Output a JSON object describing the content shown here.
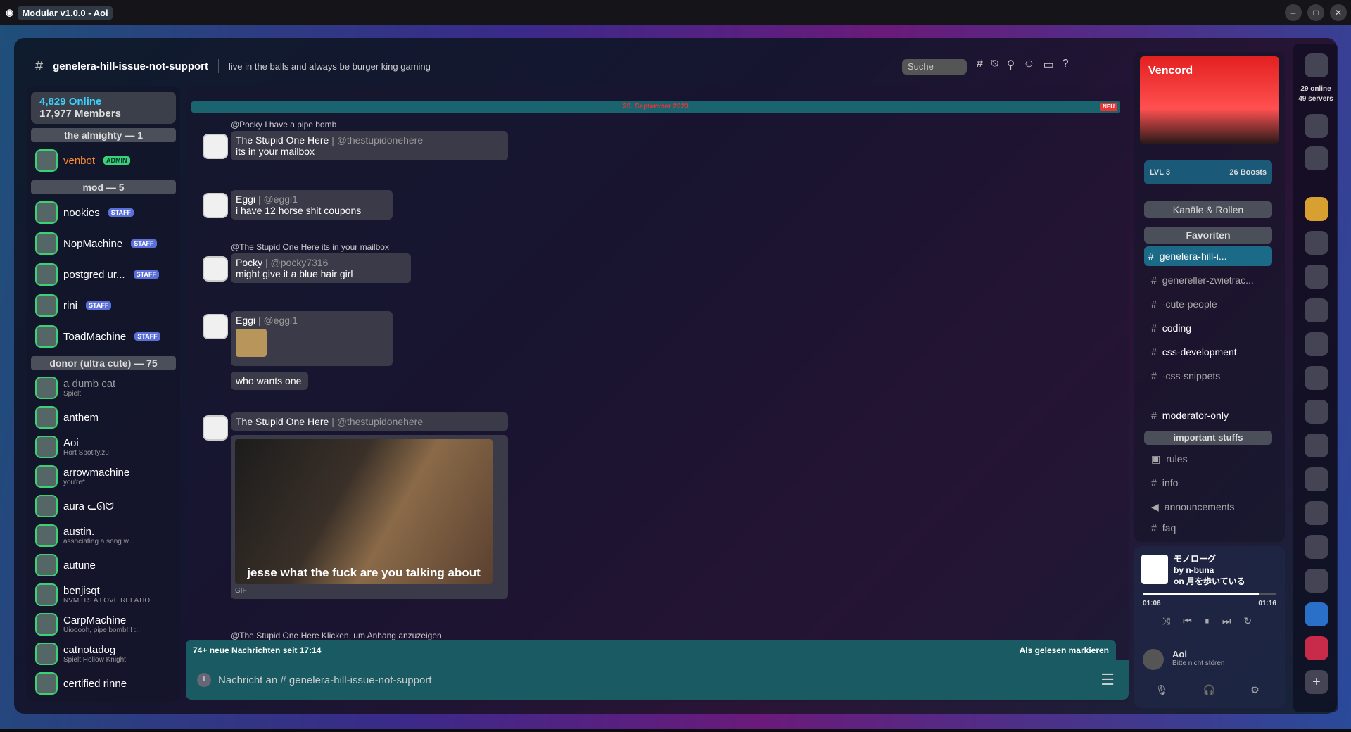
{
  "window": {
    "title": "Modular v1.0.0 - Aoi"
  },
  "header": {
    "channel": "genelera-hill-issue-not-support",
    "topic": "live in the balls and always be burger king gaming",
    "search_placeholder": "Suche"
  },
  "members": {
    "online": "4,829 Online",
    "total": "17,977 Members",
    "roles": [
      {
        "label": "the almighty — 1"
      },
      {
        "label": "mod — 5"
      },
      {
        "label": "donor (ultra cute) — 75"
      }
    ],
    "almighty": [
      {
        "name": "venbot",
        "badge": "ADMIN"
      }
    ],
    "mods": [
      {
        "name": "nookies",
        "badge": "STAFF"
      },
      {
        "name": "NopMachine",
        "badge": "STAFF"
      },
      {
        "name": "postgred ur...",
        "badge": "STAFF"
      },
      {
        "name": "rini",
        "badge": "STAFF"
      },
      {
        "name": "ToadMachine",
        "badge": "STAFF"
      }
    ],
    "donors": [
      {
        "name": "a dumb cat",
        "sub": "Spielt"
      },
      {
        "name": "anthem",
        "sub": ""
      },
      {
        "name": "Aoi",
        "sub": "Hört Spotify.zu"
      },
      {
        "name": "arrowmachine",
        "sub": "you're*"
      },
      {
        "name": "aura ᓚᘏᗢ",
        "sub": ""
      },
      {
        "name": "austin.",
        "sub": "associating a song w..."
      },
      {
        "name": "autune",
        "sub": ""
      },
      {
        "name": "benjisqt",
        "sub": "NVM ITS A LOVE RELATIO..."
      },
      {
        "name": "CarpMachine",
        "sub": "Uiooooh, pipe bomb!!! :..."
      },
      {
        "name": "catnotadog",
        "sub": "Spielt Hollow Knight"
      },
      {
        "name": "certified rinne",
        "sub": ""
      }
    ]
  },
  "chat": {
    "date": "20. September 2023",
    "new_badge": "NEU",
    "messages": [
      {
        "reply": "@Pocky I have a pipe bomb",
        "author": "The Stupid One Here",
        "handle": "| @thestupidonehere",
        "text": "its in your mailbox"
      },
      {
        "reply": "",
        "author": "Eggi",
        "handle": "| @eggi1",
        "text": "i have 12 horse shit coupons"
      },
      {
        "reply": "@The Stupid One Here its in your mailbox",
        "author": "Pocky",
        "handle": "| @pocky7316",
        "text": "might give it a blue hair girl"
      },
      {
        "reply": "",
        "author": "Eggi",
        "handle": "| @eggi1",
        "text": "who wants one"
      },
      {
        "reply": "",
        "author": "The Stupid One Here",
        "handle": "| @thestupidonehere",
        "text": "jesse what the fuck are you talking about",
        "gif": "GIF"
      },
      {
        "reply": "@The Stupid One Here Klicken, um Anhang anzuzeigen"
      }
    ],
    "new_messages": "74+ neue Nachrichten seit 17:14",
    "mark_read": "Als gelesen markieren",
    "input_placeholder": "Nachricht an # genelera-hill-issue-not-support"
  },
  "server": {
    "name": "Vencord",
    "level": "LVL 3",
    "boosts": "26 Boosts",
    "channels_roles": "Kanäle & Rollen",
    "favorites": "Favoriten",
    "channels": [
      "genelera-hill-i...",
      "genereller-zwietrac...",
      "-cute-people",
      "coding",
      "css-development",
      "-css-snippets",
      "moderator-only"
    ],
    "category": "important stuffs",
    "cat_channels": [
      "rules",
      "info",
      "announcements",
      "faq"
    ]
  },
  "player": {
    "song": "モノローグ",
    "artist": "by n-buna",
    "album": "on 月を歩いている",
    "elapsed": "01:06",
    "total": "01:16",
    "progress": 0.87
  },
  "user": {
    "name": "Aoi",
    "status": "Bitte nicht stören"
  },
  "servers": {
    "online": "29 online",
    "count": "49 servers"
  }
}
